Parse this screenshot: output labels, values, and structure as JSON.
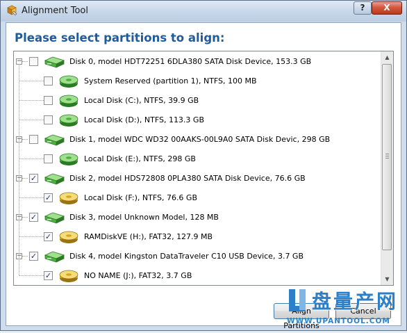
{
  "window": {
    "title": "Alignment Tool",
    "help_label": "?",
    "close_label": "X"
  },
  "heading": "Please select partitions to align:",
  "tree": {
    "items": [
      {
        "kind": "disk",
        "checked": false,
        "expander": "−",
        "label": "Disk 0, model HDT72251 6DLA380 SATA Disk Device, 153.3 GB"
      },
      {
        "kind": "partition",
        "checked": false,
        "icon_color": "green",
        "label": "System Reserved (partition 1), NTFS, 100 MB"
      },
      {
        "kind": "partition",
        "checked": false,
        "icon_color": "green",
        "label": "Local Disk (C:), NTFS, 39.9 GB"
      },
      {
        "kind": "partition",
        "checked": false,
        "icon_color": "green",
        "label": "Local Disk (D:), NTFS, 113.3 GB"
      },
      {
        "kind": "disk",
        "checked": false,
        "expander": "−",
        "label": "Disk 1, model WDC WD32 00AAKS-00L9A0 SATA Disk Devic, 298 GB"
      },
      {
        "kind": "partition",
        "checked": false,
        "icon_color": "green",
        "label": "Local Disk (E:), NTFS, 298 GB"
      },
      {
        "kind": "disk",
        "checked": true,
        "expander": "−",
        "label": "Disk 2, model HDS72808 0PLA380 SATA Disk Device, 76.6 GB"
      },
      {
        "kind": "partition",
        "checked": true,
        "icon_color": "yellow",
        "label": "Local Disk (F:), NTFS, 76.6 GB"
      },
      {
        "kind": "disk",
        "checked": true,
        "expander": "−",
        "label": "Disk 3, model Unknown Model, 128 MB"
      },
      {
        "kind": "partition",
        "checked": true,
        "icon_color": "yellow",
        "label": "RAMDiskVE (H:), FAT32, 127.9 MB"
      },
      {
        "kind": "disk",
        "checked": true,
        "expander": "−",
        "label": "Disk 4, model Kingston DataTraveler C10 USB Device, 3.7 GB"
      },
      {
        "kind": "partition",
        "checked": true,
        "icon_color": "yellow",
        "label": "NO NAME (J:), FAT32, 3.7 GB"
      }
    ]
  },
  "buttons": {
    "align_label": "Align Partitions",
    "cancel_label": "Cancel"
  },
  "watermark": {
    "brand": "盘量产网",
    "url": "WWW.UPANTOOL.COM"
  },
  "colors": {
    "heading": "#1e5c9c",
    "disk_green": "#4caf3e",
    "partition_yellow": "#d4a820",
    "close_red": "#c0381b"
  }
}
